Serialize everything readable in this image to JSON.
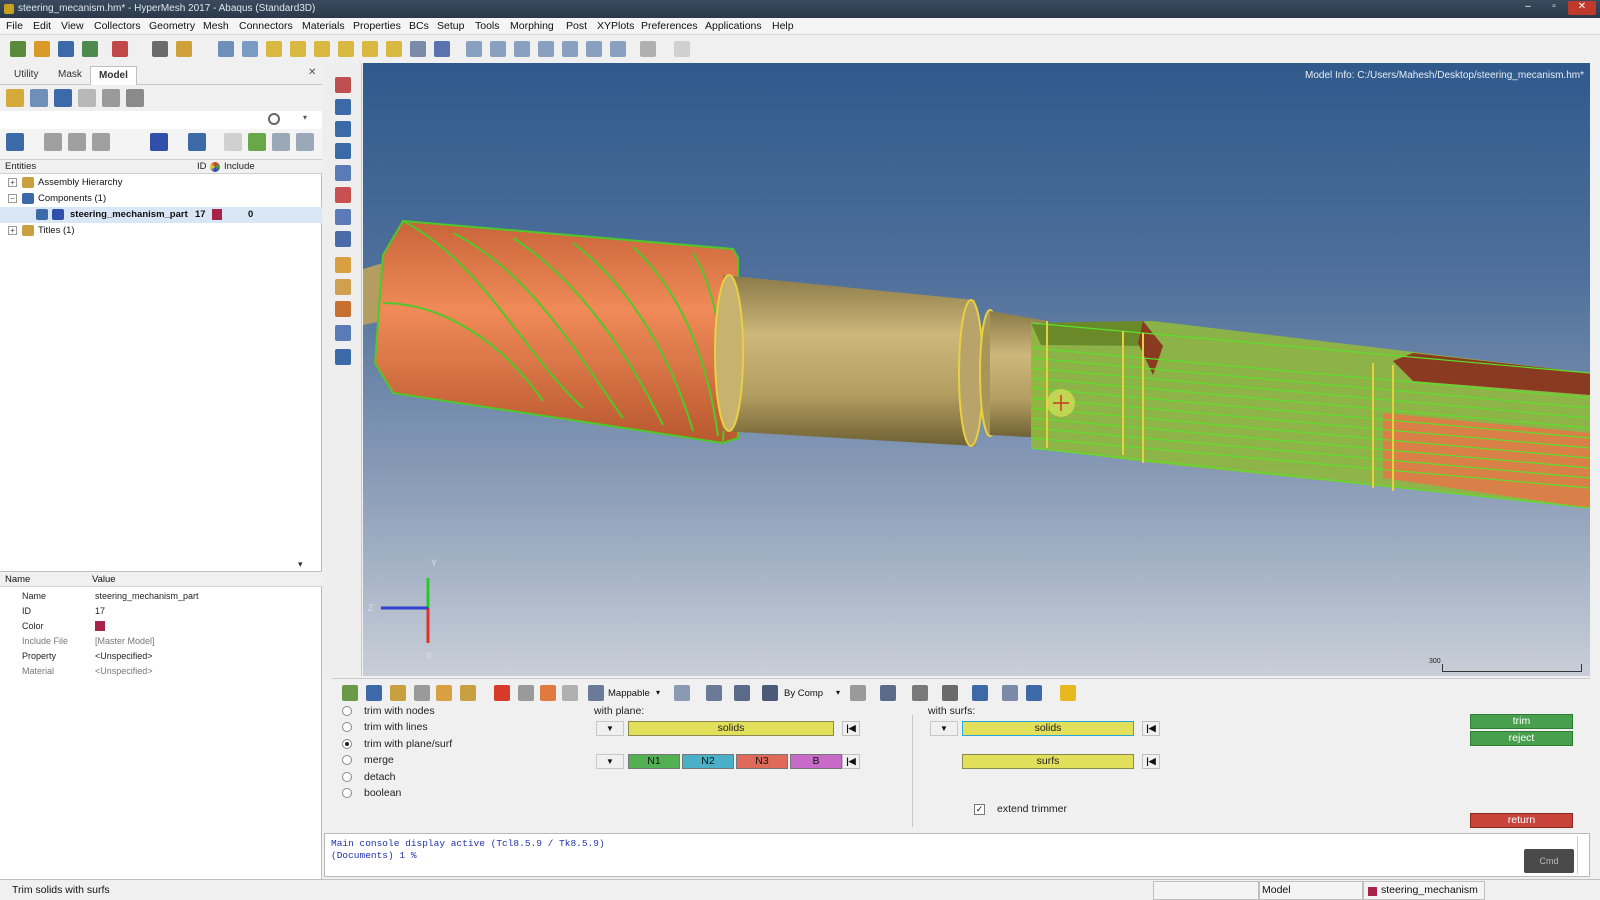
{
  "window": {
    "title": "steering_mecanism.hm* - HyperMesh 2017 - Abaqus (Standard3D)"
  },
  "menu": [
    "File",
    "Edit",
    "View",
    "Collectors",
    "Geometry",
    "Mesh",
    "Connectors",
    "Materials",
    "Properties",
    "BCs",
    "Setup",
    "Tools",
    "Morphing",
    "Post",
    "XYPlots",
    "Preferences",
    "Applications",
    "Help"
  ],
  "tabs": [
    "Utility",
    "Mask",
    "Model"
  ],
  "entity_browser": {
    "headers": {
      "entities": "Entities",
      "id": "ID",
      "include": "Include"
    },
    "tree": [
      {
        "label": "Assembly Hierarchy"
      },
      {
        "label": "Components (1)"
      },
      {
        "label": "steering_mechanism_part",
        "id": "17",
        "include": "0"
      },
      {
        "label": "Titles (1)"
      }
    ]
  },
  "properties": {
    "headers": {
      "name": "Name",
      "value": "Value"
    },
    "rows": [
      {
        "name": "Name",
        "value": "steering_mechanism_part"
      },
      {
        "name": "ID",
        "value": "17"
      },
      {
        "name": "Color",
        "value": ""
      },
      {
        "name": "Include File",
        "value": "[Master Model]"
      },
      {
        "name": "Property",
        "value": "<Unspecified>"
      },
      {
        "name": "Material",
        "value": "<Unspecified>"
      }
    ]
  },
  "viewport": {
    "model_info": "Model Info: C:/Users/Mahesh/Desktop/steering_mecanism.hm*",
    "axis_labels": {
      "y": "Y",
      "z": "Z",
      "x": "X"
    },
    "scale_label": "300"
  },
  "bottom_toolbar": {
    "mesh_type": "Mappable",
    "color_mode": "By Comp"
  },
  "trim_panel": {
    "options": [
      {
        "label": "trim with nodes",
        "selected": false
      },
      {
        "label": "trim with lines",
        "selected": false
      },
      {
        "label": "trim with plane/surf",
        "selected": true
      },
      {
        "label": "merge",
        "selected": false
      },
      {
        "label": "detach",
        "selected": false
      },
      {
        "label": "boolean",
        "selected": false
      }
    ],
    "with_plane_label": "with plane:",
    "with_plane_selector": "solids",
    "plane_nodes": [
      "N1",
      "N2",
      "N3",
      "B"
    ],
    "with_surfs_label": "with surfs:",
    "with_surfs_selector": "solids",
    "surfs_selector": "surfs",
    "extend_trimmer_label": "extend trimmer",
    "extend_trimmer_checked": true,
    "buttons": {
      "trim": "trim",
      "reject": "reject",
      "return": "return"
    }
  },
  "console": {
    "line1": "Main console display active (Tcl8.5.9 / Tk8.5.9)",
    "line2": "(Documents) 1 %",
    "cmd_button": "Cmd"
  },
  "statusbar": {
    "message": "Trim solids with surfs",
    "model": "Model",
    "component": "steering_mechanism"
  },
  "colors": {
    "viewport_top": "#2f5a8c",
    "viewport_bottom": "#c9cfd8",
    "component_color": "#a8234a",
    "button_green": "#48a04e",
    "return_red": "#c8443a",
    "selector_yellow": "#e2e05a"
  }
}
